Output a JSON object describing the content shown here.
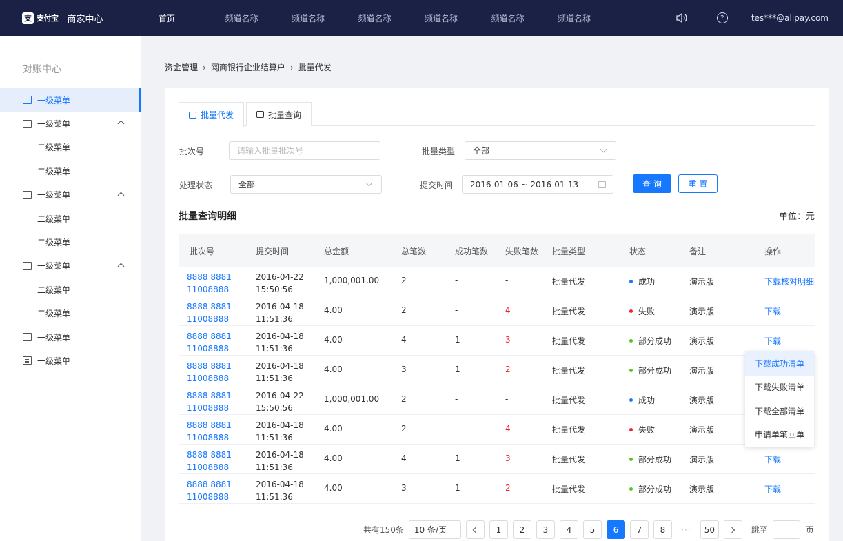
{
  "topbar": {
    "logo_mark": "支",
    "logo_text": "支付宝",
    "logo_sub": "商家中心",
    "nav": [
      "首页",
      "频道名称",
      "频道名称",
      "频道名称",
      "频道名称",
      "频道名称",
      "频道名称"
    ],
    "account": "tes***@alipay.com",
    "help_glyph": "?",
    "sound_glyph": "🔈"
  },
  "sidebar": {
    "title": "对账中心",
    "items": [
      {
        "label": "一级菜单",
        "level": 1,
        "active": true
      },
      {
        "label": "一级菜单",
        "level": 1,
        "expanded": true
      },
      {
        "label": "二级菜单",
        "level": 2
      },
      {
        "label": "二级菜单",
        "level": 2
      },
      {
        "label": "一级菜单",
        "level": 1,
        "expanded": true
      },
      {
        "label": "二级菜单",
        "level": 2
      },
      {
        "label": "二级菜单",
        "level": 2
      },
      {
        "label": "一级菜单",
        "level": 1,
        "expanded": true
      },
      {
        "label": "二级菜单",
        "level": 2
      },
      {
        "label": "二级菜单",
        "level": 2
      },
      {
        "label": "一级菜单",
        "level": 1
      },
      {
        "label": "一级菜单",
        "level": 1
      }
    ]
  },
  "breadcrumb": [
    "资金管理",
    "网商银行企业结算户",
    "批量代发"
  ],
  "tabs": [
    "批量代发",
    "批量查询"
  ],
  "form": {
    "batch_no_label": "批次号",
    "batch_no_placeholder": "请输入批量批次号",
    "batch_type_label": "批量类型",
    "batch_type_value": "全部",
    "status_label": "处理状态",
    "status_value": "全部",
    "time_label": "提交时间",
    "time_value": "2016-01-06 ~ 2016-01-13",
    "query_button": "查 询",
    "reset_button": "重 置"
  },
  "section_title": "批量查询明细",
  "unit": "单位：元",
  "table": {
    "columns": [
      "批次号",
      "提交时间",
      "总金额",
      "总笔数",
      "成功笔数",
      "失败笔数",
      "批量类型",
      "状态",
      "备注",
      "操作"
    ],
    "rows": [
      {
        "batch1": "8888 8881",
        "batch2": "11008888",
        "date": "2016-04-22",
        "time": "15:50:56",
        "amount": "1,000,001.00",
        "total": "2",
        "success": "-",
        "fail": "-",
        "type": "批量代发",
        "status": "成功",
        "status_color": "#1677ff",
        "note": "演示版",
        "action": "下载核对明细"
      },
      {
        "batch1": "8888 8881",
        "batch2": "11008888",
        "date": "2016-04-18",
        "time": "11:51:36",
        "amount": "4.00",
        "total": "2",
        "success": "-",
        "fail": "4",
        "type": "批量代发",
        "status": "失败",
        "status_color": "#f5222d",
        "note": "演示版",
        "action": "下载"
      },
      {
        "batch1": "8888 8881",
        "batch2": "11008888",
        "date": "2016-04-18",
        "time": "11:51:36",
        "amount": "4.00",
        "total": "4",
        "success": "1",
        "fail": "3",
        "type": "批量代发",
        "status": "部分成功",
        "status_color": "#52c41a",
        "note": "演示版",
        "action": "下载"
      },
      {
        "batch1": "8888 8881",
        "batch2": "11008888",
        "date": "2016-04-18",
        "time": "11:51:36",
        "amount": "4.00",
        "total": "3",
        "success": "1",
        "fail": "2",
        "type": "批量代发",
        "status": "部分成功",
        "status_color": "#52c41a",
        "note": "演示版",
        "action": ""
      },
      {
        "batch1": "8888 8881",
        "batch2": "11008888",
        "date": "2016-04-22",
        "time": "15:50:56",
        "amount": "1,000,001.00",
        "total": "2",
        "success": "-",
        "fail": "-",
        "type": "批量代发",
        "status": "成功",
        "status_color": "#1677ff",
        "note": "演示版",
        "action": ""
      },
      {
        "batch1": "8888 8881",
        "batch2": "11008888",
        "date": "2016-04-18",
        "time": "11:51:36",
        "amount": "4.00",
        "total": "2",
        "success": "-",
        "fail": "4",
        "type": "批量代发",
        "status": "失败",
        "status_color": "#f5222d",
        "note": "演示版",
        "action": ""
      },
      {
        "batch1": "8888 8881",
        "batch2": "11008888",
        "date": "2016-04-18",
        "time": "11:51:36",
        "amount": "4.00",
        "total": "4",
        "success": "1",
        "fail": "3",
        "type": "批量代发",
        "status": "部分成功",
        "status_color": "#52c41a",
        "note": "演示版",
        "action": "下载"
      },
      {
        "batch1": "8888 8881",
        "batch2": "11008888",
        "date": "2016-04-18",
        "time": "11:51:36",
        "amount": "4.00",
        "total": "3",
        "success": "1",
        "fail": "2",
        "type": "批量代发",
        "status": "部分成功",
        "status_color": "#52c41a",
        "note": "演示版",
        "action": "下载"
      }
    ]
  },
  "dropdown": [
    "下载成功清单",
    "下载失败清单",
    "下载全部清单",
    "申请单笔回单"
  ],
  "pagination": {
    "total": "共有150条",
    "page_size": "10 条/页",
    "pages": [
      "1",
      "2",
      "3",
      "4",
      "5",
      "6",
      "7",
      "8"
    ],
    "current": "6",
    "ellipsis": "···",
    "last": "50",
    "jump_label": "跳至",
    "page_suffix": "页"
  },
  "colors": {
    "primary": "#1677ff",
    "topbar": "#1a2144",
    "fail": "#f5222d",
    "partial": "#52c41a"
  }
}
